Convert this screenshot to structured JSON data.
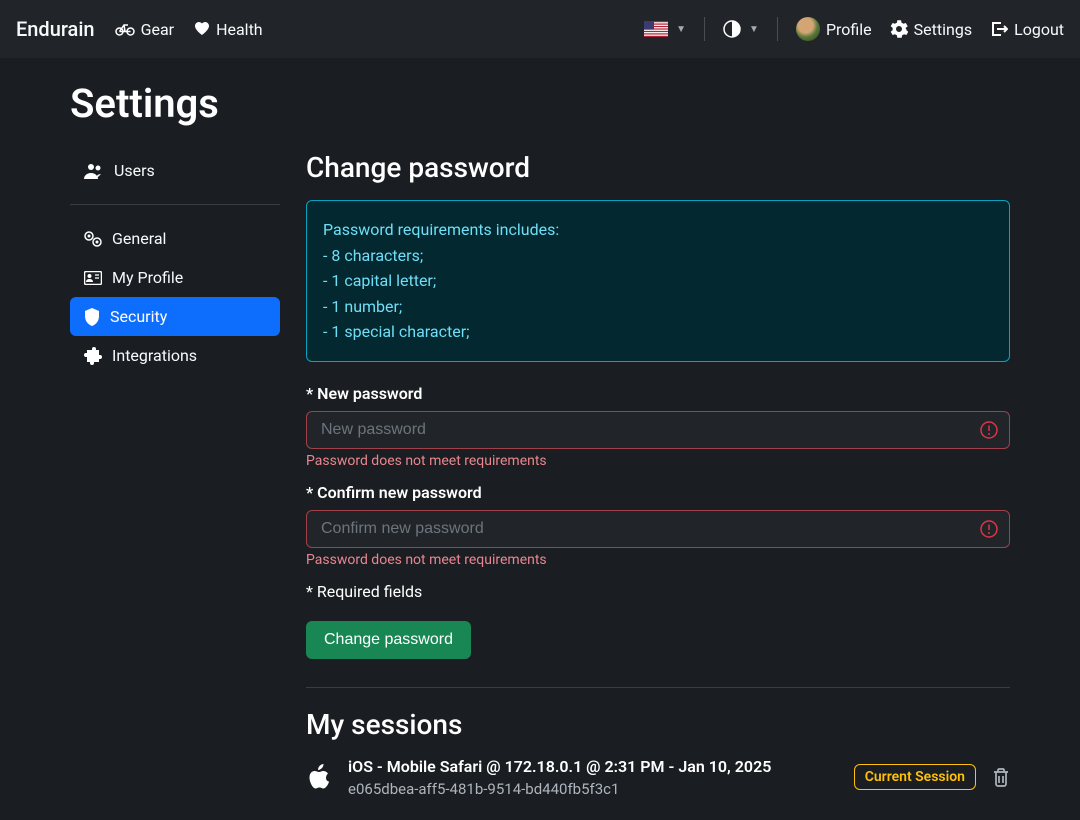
{
  "navbar": {
    "brand": "Endurain",
    "gear": "Gear",
    "health": "Health",
    "profile": "Profile",
    "settings": "Settings",
    "logout": "Logout"
  },
  "page": {
    "title": "Settings"
  },
  "sidebar": {
    "items": [
      {
        "label": "Users"
      },
      {
        "label": "General"
      },
      {
        "label": "My Profile"
      },
      {
        "label": "Security"
      },
      {
        "label": "Integrations"
      }
    ]
  },
  "password": {
    "title": "Change password",
    "req_header": "Password requirements includes:",
    "req1": "- 8 characters;",
    "req2": "- 1 capital letter;",
    "req3": "- 1 number;",
    "req4": "- 1 special character;",
    "new_label": "* New password",
    "new_placeholder": "New password",
    "new_error": "Password does not meet requirements",
    "confirm_label": "* Confirm new password",
    "confirm_placeholder": "Confirm new password",
    "confirm_error": "Password does not meet requirements",
    "required_note": "* Required fields",
    "submit": "Change password"
  },
  "sessions": {
    "title": "My sessions",
    "row": {
      "title": "iOS - Mobile Safari @ 172.18.0.1 @ 2:31 PM - Jan 10, 2025",
      "id": "e065dbea-aff5-481b-9514-bd440fb5f3c1",
      "badge": "Current Session"
    }
  }
}
